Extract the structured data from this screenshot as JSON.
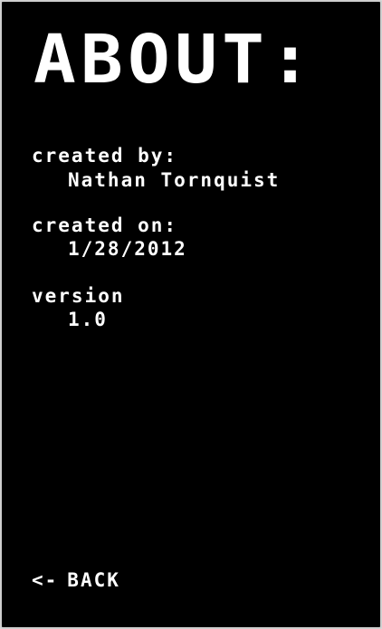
{
  "title": "ABOUT:",
  "fields": [
    {
      "label": "created by:",
      "value": "Nathan Tornquist"
    },
    {
      "label": "created on:",
      "value": "1/28/2012"
    },
    {
      "label": "version",
      "value": "1.0"
    }
  ],
  "back": {
    "arrow": "<-",
    "label": "BACK"
  }
}
